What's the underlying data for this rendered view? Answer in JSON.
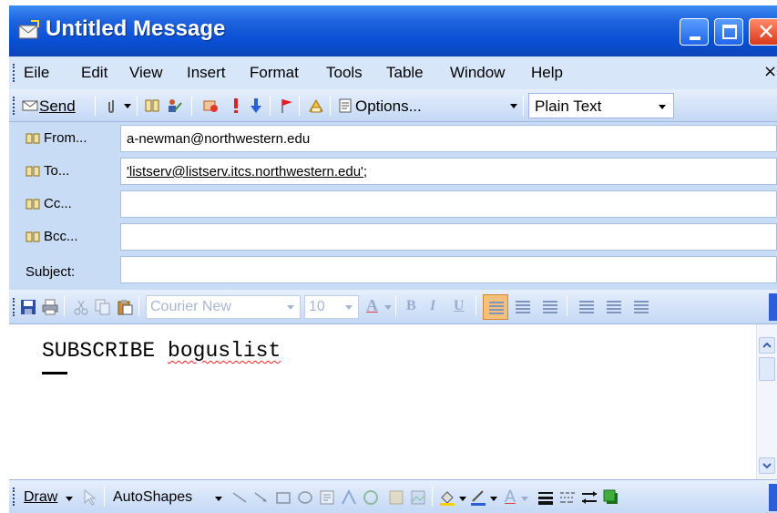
{
  "window": {
    "title": "Untitled Message",
    "close_glyph": "✕"
  },
  "menubar": {
    "items": [
      "Eile",
      "Edit",
      "View",
      "Insert",
      "Format",
      "Tools",
      "Table",
      "Window",
      "Help"
    ],
    "close_glyph": "×"
  },
  "toolbar": {
    "send_label": "Send",
    "options_label": "Options...",
    "format_value": "Plain Text"
  },
  "headers": {
    "from_label": "From...",
    "from_value": "a-newman@northwestern.edu",
    "to_label": "To...",
    "to_value": "'listserv@listserv.itcs.northwestern.edu';",
    "cc_label": "Cc...",
    "cc_value": "",
    "bcc_label": "Bcc...",
    "bcc_value": "",
    "subject_label": "Subject:",
    "subject_value": ""
  },
  "formatting": {
    "font_name": "Courier New",
    "font_size": "10",
    "font_color_label": "A",
    "bold_label": "B",
    "italic_label": "I",
    "underline_label": "U"
  },
  "body": {
    "command": "SUBSCRIBE",
    "list_name": "boguslist"
  },
  "drawbar": {
    "draw_label": "Draw",
    "autoshapes_label": "AutoShapes",
    "font_color_label": "A"
  },
  "colors": {
    "titlebar": "#0a4fd4",
    "header_bg": "#c9dcf5",
    "active_align": "#f7c07a",
    "spell_error": "#ff2020"
  }
}
